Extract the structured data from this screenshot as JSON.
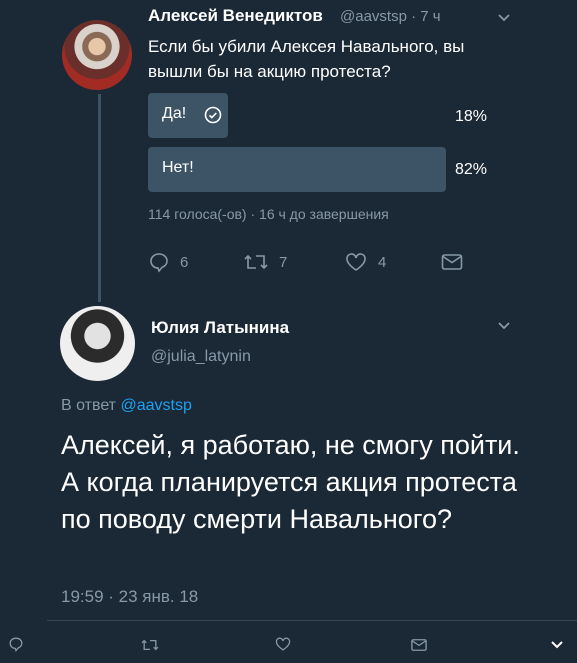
{
  "original_tweet": {
    "author_name": "Алексей Венедиктов",
    "handle": "@aavstsp",
    "time": "· 7 ч",
    "text": "Если бы убили Алексея Навального, вы вышли бы на акцию протеста?",
    "poll": {
      "options": [
        {
          "label": "Да!",
          "percent": "18%",
          "value": 18,
          "selected": true
        },
        {
          "label": "Нет!",
          "percent": "82%",
          "value": 82,
          "selected": false
        }
      ],
      "meta": "114 голоса(-ов) · 16 ч до завершения"
    },
    "actions": {
      "replies": "6",
      "retweets": "7",
      "likes": "4"
    }
  },
  "reply_tweet": {
    "author_name": "Юлия Латынина",
    "handle": "@julia_latynin",
    "reply_prefix": "В ответ",
    "reply_handle": "@aavstsp",
    "text": "Алексей, я работаю, не смогу пойти. А когда планируется акция протеста по поводу смерти Навального?",
    "timestamp": "19:59 · 23 янв. 18"
  },
  "icons": [
    "chevron-down-icon",
    "check-circle-icon",
    "reply-icon",
    "retweet-icon",
    "like-icon",
    "message-icon"
  ],
  "colors": {
    "background": "#1b2836",
    "secondary_text": "#8899a6",
    "link": "#1da1f2",
    "poll_bar": "#3d5466"
  }
}
